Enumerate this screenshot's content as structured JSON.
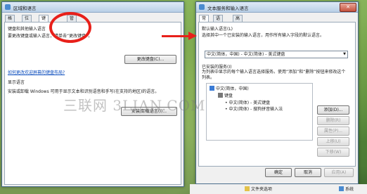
{
  "left_window": {
    "title": "区域和语言",
    "tabs": [
      "格式",
      "位置",
      "键盘和语言",
      "管理"
    ],
    "group1_label": "键盘和其他输入语言",
    "group1_text": "要更改键盘或输入语言，请单击“更改键盘”。",
    "change_keyboard_btn": "更改键盘(C)...",
    "link": "如何更改欢迎屏幕的键盘布局?",
    "group2_label": "显示语言",
    "group2_text": "安装或卸载 Windows 可用于显示文本和识别语音和手写(在支持的地区)的语言。",
    "install_btn": "安装/卸载语言(I)..."
  },
  "right_window": {
    "title": "文本服务和输入语言",
    "tabs": [
      "常规",
      "语言栏",
      "高级键设置"
    ],
    "default_label": "默认输入语言(L)",
    "default_desc": "选择其中一个已安装的输入语言，用作所有输入字段的默认语言。",
    "default_select": "中文(简体，中国) - 中文(简体) - 美式键盘",
    "installed_label": "已安装的服务(I)",
    "installed_desc": "为列表中显示的每个输入语言选择服务。使用“添加”和“删除”按钮来修改这个列表。",
    "tree": {
      "lang": "中文(简体，中国)",
      "category": "键盘",
      "items": [
        "中文(简体) - 美式键盘",
        "中文(简体) - 搜狗拼音输入法"
      ]
    },
    "buttons": {
      "add": "添加(D)...",
      "remove": "删除(R)",
      "properties": "属性(P)...",
      "up": "上移(U)",
      "down": "下移(W)"
    },
    "ok": "确定",
    "cancel": "取消",
    "apply": "应用(A)"
  },
  "watermark": "三联网 3LIAN.COM",
  "taskbar": {
    "item1": "文件夹选项",
    "item2": "系统"
  },
  "colors": {
    "annotation": "#e8201a",
    "link": "#0a4cbd"
  }
}
